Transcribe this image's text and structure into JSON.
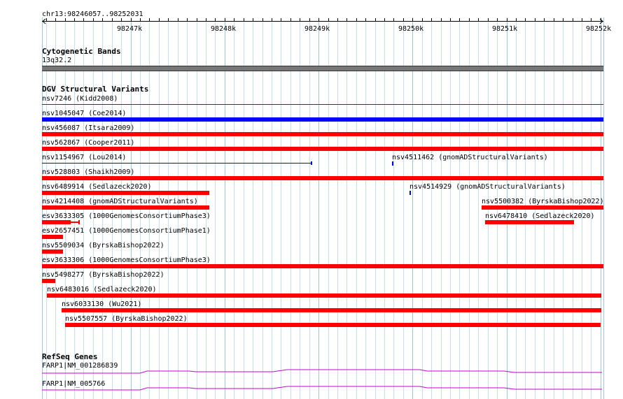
{
  "ruler": {
    "locus": "chr13:98246057..98252031",
    "ticks": [
      "98247k",
      "98248k",
      "98249k",
      "98250k",
      "98251k",
      "98252k"
    ]
  },
  "cytoband_track": {
    "title": "Cytogenetic Bands",
    "band": "13q32.2"
  },
  "dgv_track": {
    "title": "DGV Structural Variants",
    "features": [
      {
        "id": "nsv7246",
        "label": "nsv7246 (Kidd2008)",
        "start": 98246057,
        "end": 98252031,
        "color": "#800080",
        "style": "thin"
      },
      {
        "id": "nsv1045047",
        "label": "nsv1045047 (Coe2014)",
        "start": 98246057,
        "end": 98252031,
        "color": "#0000ff",
        "style": "bar"
      },
      {
        "id": "nsv456087",
        "label": "nsv456087 (Itsara2009)",
        "start": 98246057,
        "end": 98252031,
        "color": "#ff0000",
        "style": "bar"
      },
      {
        "id": "nsv562867",
        "label": "nsv562867 (Cooper2011)",
        "start": 98246057,
        "end": 98252031,
        "color": "#ff0000",
        "style": "bar"
      },
      {
        "id": "nsv1154967",
        "label": "nsv1154967 (Lou2014)",
        "start": 98246057,
        "end": 98248925,
        "color": "#0000ff",
        "style": "line"
      },
      {
        "id": "nsv4511462",
        "label": "nsv4511462 (gnomADStructuralVariants)",
        "start": 98249780,
        "end": 98249800,
        "color": "#0000ff",
        "style": "tick"
      },
      {
        "id": "nsv528803",
        "label": "nsv528803 (Shaikh2009)",
        "start": 98246057,
        "end": 98252031,
        "color": "#ff0000",
        "style": "bar"
      },
      {
        "id": "nsv6489914",
        "label": "nsv6489914 (Sedlazeck2020)",
        "start": 98246057,
        "end": 98247835,
        "color": "#ff0000",
        "style": "bar"
      },
      {
        "id": "nsv4514929",
        "label": "nsv4514929 (gnomADStructuralVariants)",
        "start": 98249965,
        "end": 98249985,
        "color": "#0000ff",
        "style": "tick"
      },
      {
        "id": "nsv4214408",
        "label": "nsv4214408 (gnomADStructuralVariants)",
        "start": 98246057,
        "end": 98247835,
        "color": "#ff0000",
        "style": "bar"
      },
      {
        "id": "nsv5500382",
        "label": "nsv5500382 (ByrskaBishop2022)",
        "start": 98250735,
        "end": 98252031,
        "color": "#ff0000",
        "style": "bar"
      },
      {
        "id": "esv3633305",
        "label": "esv3633305 (1000GenomesConsortiumPhase3)",
        "start": 98246057,
        "end": 98246450,
        "color": "#ff0000",
        "style": "bar-end"
      },
      {
        "id": "nsv6478410",
        "label": "nsv6478410 (Sedlazeck2020)",
        "start": 98250775,
        "end": 98251720,
        "color": "#ff0000",
        "style": "bar"
      },
      {
        "id": "esv2657451",
        "label": "esv2657451 (1000GenomesConsortiumPhase1)",
        "start": 98246057,
        "end": 98246280,
        "color": "#ff0000",
        "style": "bar"
      },
      {
        "id": "nsv5509034",
        "label": "nsv5509034 (ByrskaBishop2022)",
        "start": 98246057,
        "end": 98246280,
        "color": "#ff0000",
        "style": "bar"
      },
      {
        "id": "esv3633306",
        "label": "esv3633306 (1000GenomesConsortiumPhase3)",
        "start": 98246057,
        "end": 98252031,
        "color": "#ff0000",
        "style": "bar"
      },
      {
        "id": "nsv5498277",
        "label": "nsv5498277 (ByrskaBishop2022)",
        "start": 98246057,
        "end": 98246200,
        "color": "#ff0000",
        "style": "bar"
      },
      {
        "id": "nsv6483016",
        "label": "nsv6483016 (Sedlazeck2020)",
        "start": 98246110,
        "end": 98252010,
        "color": "#ff0000",
        "style": "bar"
      },
      {
        "id": "nsv6033130",
        "label": "nsv6033130 (Wu2021)",
        "start": 98246265,
        "end": 98252010,
        "color": "#ff0000",
        "style": "bar"
      },
      {
        "id": "nsv5507557",
        "label": "nsv5507557 (ByrskaBishop2022)",
        "start": 98246300,
        "end": 98252005,
        "color": "#ff0000",
        "style": "bar"
      }
    ]
  },
  "refseq_track": {
    "title": "RefSeq Genes",
    "genes": [
      {
        "label": "FARP1|NM_001286839",
        "color": "#cc00cc"
      },
      {
        "label": "FARP1|NM_005766",
        "color": "#cc00cc"
      }
    ]
  },
  "colors": {
    "grid": "#9ec8e8",
    "ruler": "#000000",
    "cytoband": "#777777"
  }
}
